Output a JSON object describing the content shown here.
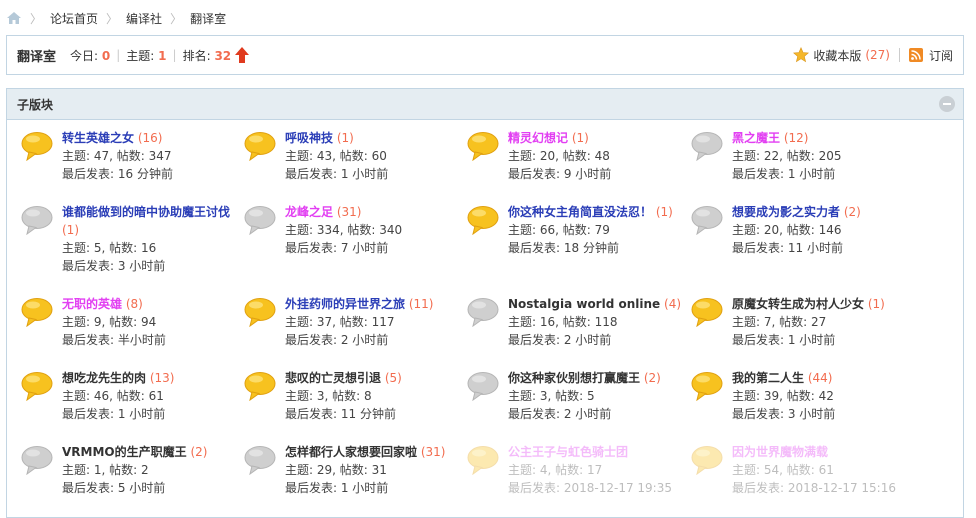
{
  "breadcrumb": {
    "home_icon": "home-icon",
    "items": [
      "论坛首页",
      "编译社",
      "翻译室"
    ]
  },
  "header": {
    "forum_name": "翻译室",
    "today_label": "今日:",
    "today_value": "0",
    "threads_label": "主题:",
    "threads_value": "1",
    "rank_label": "排名:",
    "rank_value": "32",
    "rank_icon": "rank-up-arrow-icon",
    "favorite_label": "收藏本版",
    "favorite_count": "(27)",
    "subscribe_label": "订阅"
  },
  "panel": {
    "title": "子版块",
    "collapse_icon": "collapse-icon"
  },
  "colors": {
    "accent": "#f26c4f",
    "link": "#2b3eb7",
    "pink": "#e23ff2",
    "border": "#c2d5e3",
    "title_bg": "#e5edf2"
  },
  "subforums": [
    {
      "name": "转生英雄之女",
      "count": "(16)",
      "stats": "主题: 47, 帖数: 347",
      "last": "最后发表: 16 分钟前",
      "color": "blue",
      "icon": "yellow"
    },
    {
      "name": "呼吸神技",
      "count": "(1)",
      "stats": "主题: 43, 帖数: 60",
      "last": "最后发表: 1 小时前",
      "color": "blue",
      "icon": "yellow"
    },
    {
      "name": "精灵幻想记",
      "count": "(1)",
      "stats": "主题: 20, 帖数: 48",
      "last": "最后发表: 9 小时前",
      "color": "pink",
      "icon": "yellow"
    },
    {
      "name": "黑之魔王",
      "count": "(12)",
      "stats": "主题: 22, 帖数: 205",
      "last": "最后发表: 1 小时前",
      "color": "pink",
      "icon": "gray"
    },
    {
      "name": "谁都能做到的暗中协助魔王讨伐",
      "count": "(1)",
      "stats": "主题: 5, 帖数: 16",
      "last": "最后发表: 3 小时前",
      "color": "blue",
      "icon": "gray"
    },
    {
      "name": "龙峰之足",
      "count": "(31)",
      "stats": "主题: 334, 帖数: 340",
      "last": "最后发表: 7 小时前",
      "color": "pink",
      "icon": "gray"
    },
    {
      "name": "你这种女主角简直没法忍！",
      "count": "(1)",
      "stats": "主题: 66, 帖数: 79",
      "last": "最后发表: 18 分钟前",
      "color": "blue",
      "icon": "yellow"
    },
    {
      "name": "想要成为影之实力者",
      "count": "(2)",
      "stats": "主题: 20, 帖数: 146",
      "last": "最后发表: 11 小时前",
      "color": "blue",
      "icon": "gray"
    },
    {
      "name": "无职的英雄",
      "count": "(8)",
      "stats": "主题: 9, 帖数: 94",
      "last": "最后发表: 半小时前",
      "color": "pink",
      "icon": "yellow"
    },
    {
      "name": "外挂药师的异世界之旅",
      "count": "(11)",
      "stats": "主题: 37, 帖数: 117",
      "last": "最后发表: 2 小时前",
      "color": "blue",
      "icon": "yellow"
    },
    {
      "name": "Nostalgia world online",
      "count": "(4)",
      "stats": "主题: 16, 帖数: 118",
      "last": "最后发表: 2 小时前",
      "color": "dark",
      "icon": "gray"
    },
    {
      "name": "原魔女转生成为村人少女",
      "count": "(1)",
      "stats": "主题: 7, 帖数: 27",
      "last": "最后发表: 1 小时前",
      "color": "dark",
      "icon": "yellow"
    },
    {
      "name": "想吃龙先生的肉",
      "count": "(13)",
      "stats": "主题: 46, 帖数: 61",
      "last": "最后发表: 1 小时前",
      "color": "dark",
      "icon": "yellow"
    },
    {
      "name": "悲叹的亡灵想引退",
      "count": "(5)",
      "stats": "主题: 3, 帖数: 8",
      "last": "最后发表: 11 分钟前",
      "color": "dark",
      "icon": "yellow"
    },
    {
      "name": "你这种家伙别想打赢魔王",
      "count": "(2)",
      "stats": "主题: 3, 帖数: 5",
      "last": "最后发表: 2 小时前",
      "color": "dark",
      "icon": "gray"
    },
    {
      "name": "我的第二人生",
      "count": "(44)",
      "stats": "主题: 39, 帖数: 42",
      "last": "最后发表: 3 小时前",
      "color": "dark",
      "icon": "yellow"
    },
    {
      "name": "VRMMO的生产职魔王",
      "count": "(2)",
      "stats": "主题: 1, 帖数: 2",
      "last": "最后发表: 5 小时前",
      "color": "dark",
      "icon": "gray"
    },
    {
      "name": "怎样都行人家想要回家啦",
      "count": "(31)",
      "stats": "主题: 29, 帖数: 31",
      "last": "最后发表: 1 小时前",
      "color": "dark",
      "icon": "gray"
    },
    {
      "name": "公主王子与虹色骑士团",
      "count": "",
      "stats": "主题: 4, 帖数: 17",
      "last": "最后发表: 2018-12-17 19:35",
      "color": "pink",
      "icon": "yellow",
      "faded": true
    },
    {
      "name": "因为世界魔物满载",
      "count": "",
      "stats": "主题: 54, 帖数: 61",
      "last": "最后发表: 2018-12-17 15:16",
      "color": "pink",
      "icon": "yellow",
      "faded": true
    }
  ]
}
